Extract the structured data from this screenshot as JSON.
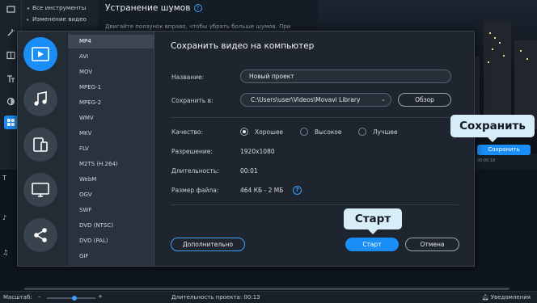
{
  "app": {
    "tools_menu": {
      "all_tools": "Все инструменты",
      "change_video": "Изменение видео"
    },
    "noise_panel": {
      "title": "Устранение шумов",
      "help": "?",
      "hint": "Двигайте ползунок вправо, чтобы убрать больше шумов. При"
    },
    "timeline": {
      "ruler_label": "00:00:16"
    },
    "footer": {
      "zoom_label": "Масштаб:",
      "zoom_minus": "–",
      "zoom_plus": "+",
      "duration_label": "Длительность проекта:",
      "duration_value": "00:13",
      "notifications": "Уведомления"
    },
    "save_button": "Сохранить"
  },
  "dialog": {
    "title": "Сохранить видео на компьютер",
    "categories": [
      {
        "name": "video",
        "icon": "play-icon",
        "active": true
      },
      {
        "name": "audio",
        "icon": "music-note-icon",
        "active": false
      },
      {
        "name": "devices",
        "icon": "phone-tablet-icon",
        "active": false
      },
      {
        "name": "tv",
        "icon": "monitor-icon",
        "active": false
      },
      {
        "name": "share",
        "icon": "share-icon",
        "active": false
      }
    ],
    "formats": [
      "MP4",
      "AVI",
      "MOV",
      "MPEG-1",
      "MPEG-2",
      "WMV",
      "MKV",
      "FLV",
      "M2TS (H.264)",
      "WebM",
      "OGV",
      "SWF",
      "DVD (NTSC)",
      "DVD (PAL)",
      "GIF"
    ],
    "selected_format": "MP4",
    "name_label": "Название:",
    "name_value": "Новый проект",
    "save_to_label": "Сохранить в:",
    "save_to_value": "C:\\Users\\user\\Videos\\Movavi Library",
    "browse_button": "Обзор",
    "quality_label": "Качество:",
    "quality_options": [
      "Хорошее",
      "Высокое",
      "Лучшее"
    ],
    "quality_selected": "Хорошее",
    "resolution_label": "Разрешение:",
    "resolution_value": "1920x1080",
    "duration_label": "Длительность:",
    "duration_value": "00:01",
    "filesize_label": "Размер файла:",
    "filesize_value": "464 КБ - 2 МБ",
    "info": "?",
    "advanced_button": "Дополнительно",
    "start_button": "Старт",
    "cancel_button": "Отмена"
  },
  "callouts": {
    "save": "Сохранить",
    "start": "Старт"
  },
  "colors": {
    "accent": "#1a8ef7",
    "dialog_bg": "#1e252e",
    "callout_bg": "#d7eef8"
  }
}
